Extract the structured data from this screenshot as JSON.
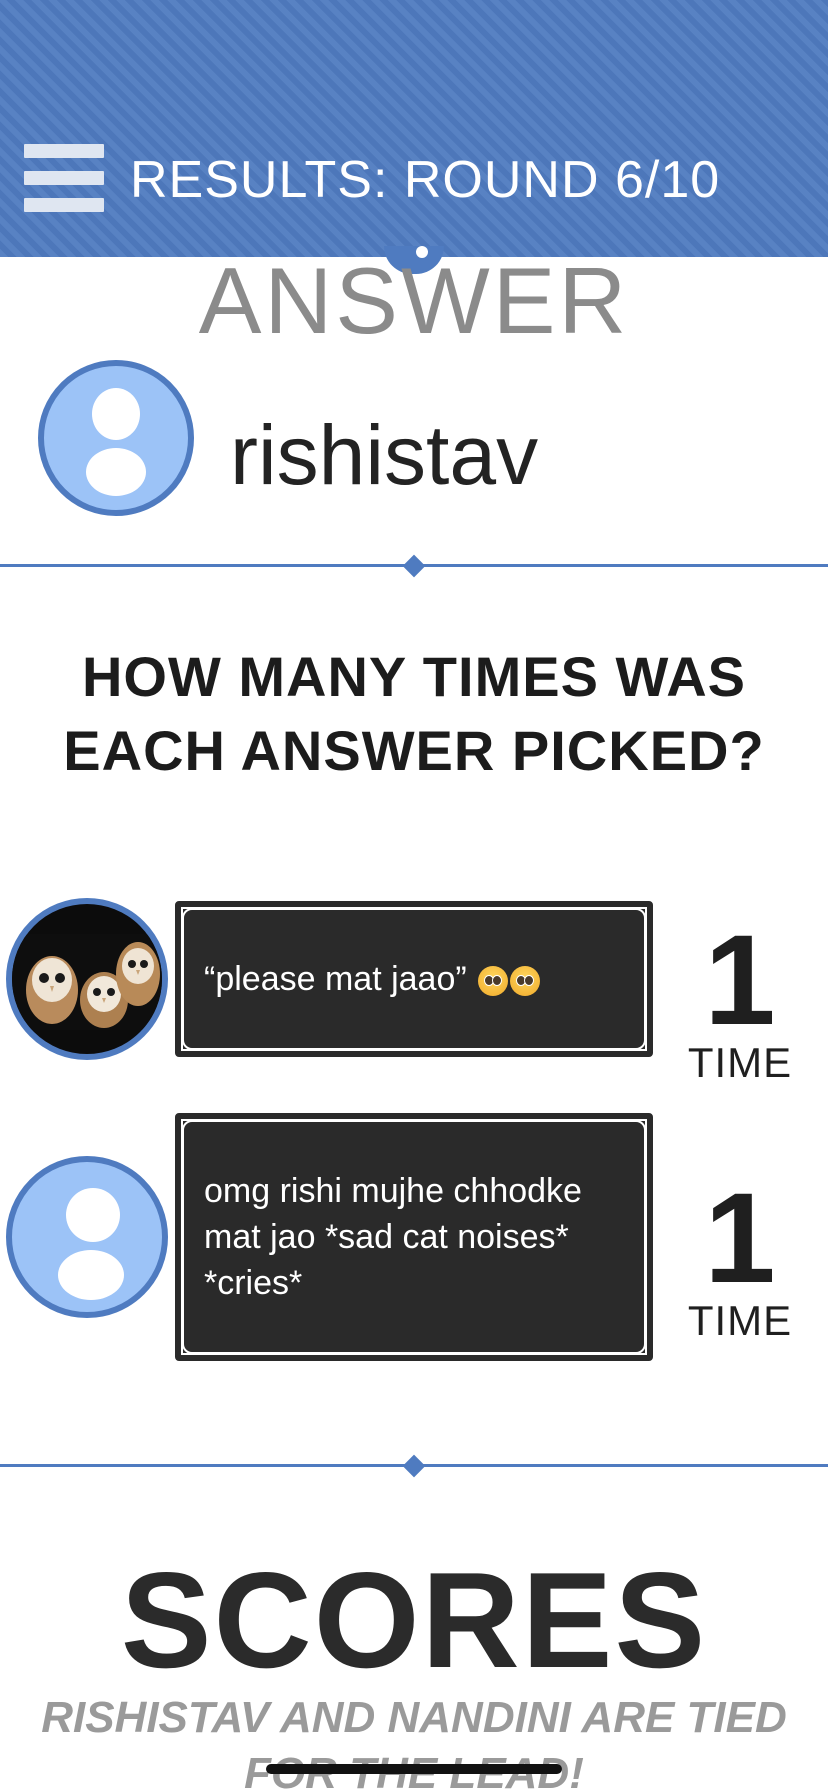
{
  "header": {
    "title": "RESULTS: ROUND 6/10",
    "menu_icon": "hamburger-menu-icon",
    "background_color": "#4f7bc0"
  },
  "answer_section": {
    "heading": "ANSWER",
    "author": {
      "name": "rishistav",
      "avatar_icon": "default-user-avatar-icon"
    }
  },
  "question": {
    "line1": "HOW MANY TIMES WAS",
    "line2": "EACH ANSWER PICKED?"
  },
  "answers": [
    {
      "text": "“please mat jaao”",
      "emoji": "pleading-face-emoji x2",
      "avatar": "owl-photo-avatar",
      "count": "1",
      "count_unit": "TIME"
    },
    {
      "text": "omg rishi mujhe chhodke mat jao *sad cat noises* *cries*",
      "avatar": "default-user-avatar-icon",
      "count": "1",
      "count_unit": "TIME"
    }
  ],
  "scores": {
    "heading": "SCORES",
    "subtitle": "RISHISTAV AND NANDINI ARE TIED FOR THE LEAD!"
  },
  "colors": {
    "accent": "#4f7bc0",
    "avatar_fill": "#9cc3f7",
    "answer_box": "#2a2a2a"
  }
}
